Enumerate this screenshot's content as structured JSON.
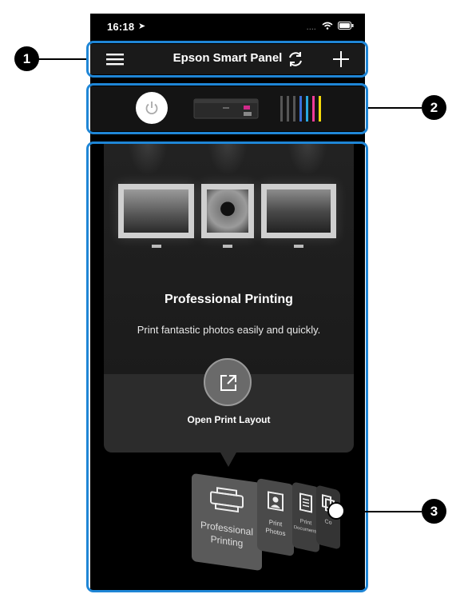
{
  "status": {
    "time": "16:18",
    "signal": "....",
    "icons": [
      "location-icon",
      "wifi-icon",
      "battery-icon"
    ]
  },
  "nav": {
    "title": "Epson Smart Panel",
    "icons": [
      "menu-icon",
      "refresh-icon",
      "add-icon"
    ]
  },
  "printer": {
    "icons": [
      "power-icon",
      "printer-icon",
      "ink-levels-icon"
    ]
  },
  "feature": {
    "heading": "Professional Printing",
    "subtitle": "Print fantastic photos easily and quickly.",
    "action_label": "Open Print Layout"
  },
  "carousel": {
    "items": [
      {
        "label_line1": "Professional",
        "label_line2": "Printing",
        "icon": "large-printer-icon"
      },
      {
        "label_line1": "Print",
        "label_line2": "Photos",
        "icon": "photo-icon"
      },
      {
        "label_line1": "Print",
        "label_line2": "Documents",
        "icon": "document-icon"
      },
      {
        "label_line1": "Co",
        "label_line2": "",
        "icon": "copy-icon"
      }
    ]
  },
  "callouts": [
    "1",
    "2",
    "3"
  ],
  "colors": {
    "highlight": "#1f86d6",
    "ink": [
      "#f2f2f2",
      "#3b6fd8",
      "#29a8e0",
      "#f03c9a",
      "#f5d90a"
    ]
  }
}
